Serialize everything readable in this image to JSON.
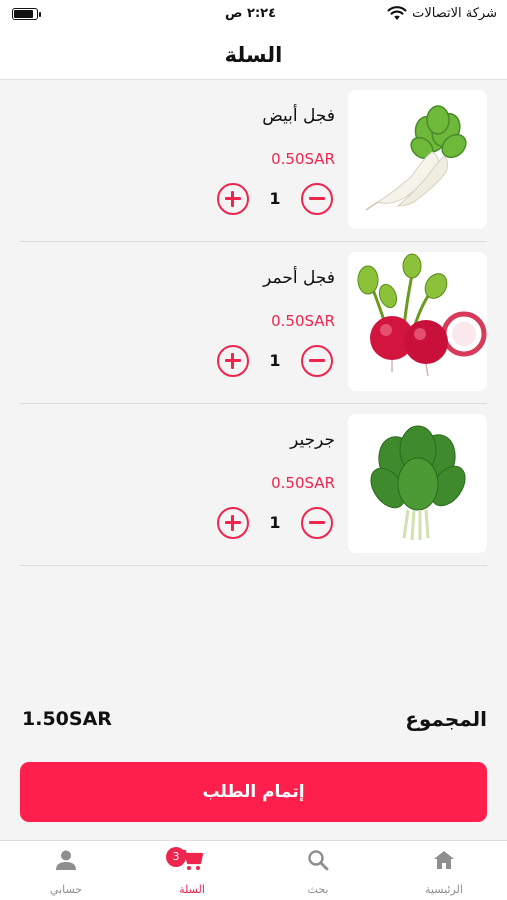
{
  "status_bar": {
    "carrier": "شركة الاتصالات",
    "time": "٢:٢٤ ص",
    "wifi_icon": "wifi-icon",
    "battery_icon": "battery-icon"
  },
  "header": {
    "title": "السلة"
  },
  "cart": {
    "items": [
      {
        "name": "فجل أبيض",
        "price": "0.50SAR",
        "quantity": "1",
        "image": "white-radish-image"
      },
      {
        "name": "فجل أحمر",
        "price": "0.50SAR",
        "quantity": "1",
        "image": "red-radish-image"
      },
      {
        "name": "جرجير",
        "price": "0.50SAR",
        "quantity": "1",
        "image": "arugula-image"
      }
    ],
    "plus_icon": "plus-circle-icon",
    "minus_icon": "minus-circle-icon"
  },
  "summary": {
    "total_label": "المجموع",
    "total_value": "1.50SAR"
  },
  "checkout_button": {
    "label": "إتمام الطلب"
  },
  "tabbar": {
    "tabs": [
      {
        "label": "الرئيسية",
        "icon": "home-icon",
        "active": false
      },
      {
        "label": "بحث",
        "icon": "search-icon",
        "active": false
      },
      {
        "label": "السلة",
        "icon": "cart-icon",
        "active": true,
        "badge": "3"
      },
      {
        "label": "حسابي",
        "icon": "user-icon",
        "active": false
      }
    ]
  },
  "colors": {
    "accent": "#f0254e",
    "button": "#fe1f4c",
    "background": "#f4f4f4",
    "card": "#ffffff",
    "tab_inactive": "#8e8e8e"
  }
}
